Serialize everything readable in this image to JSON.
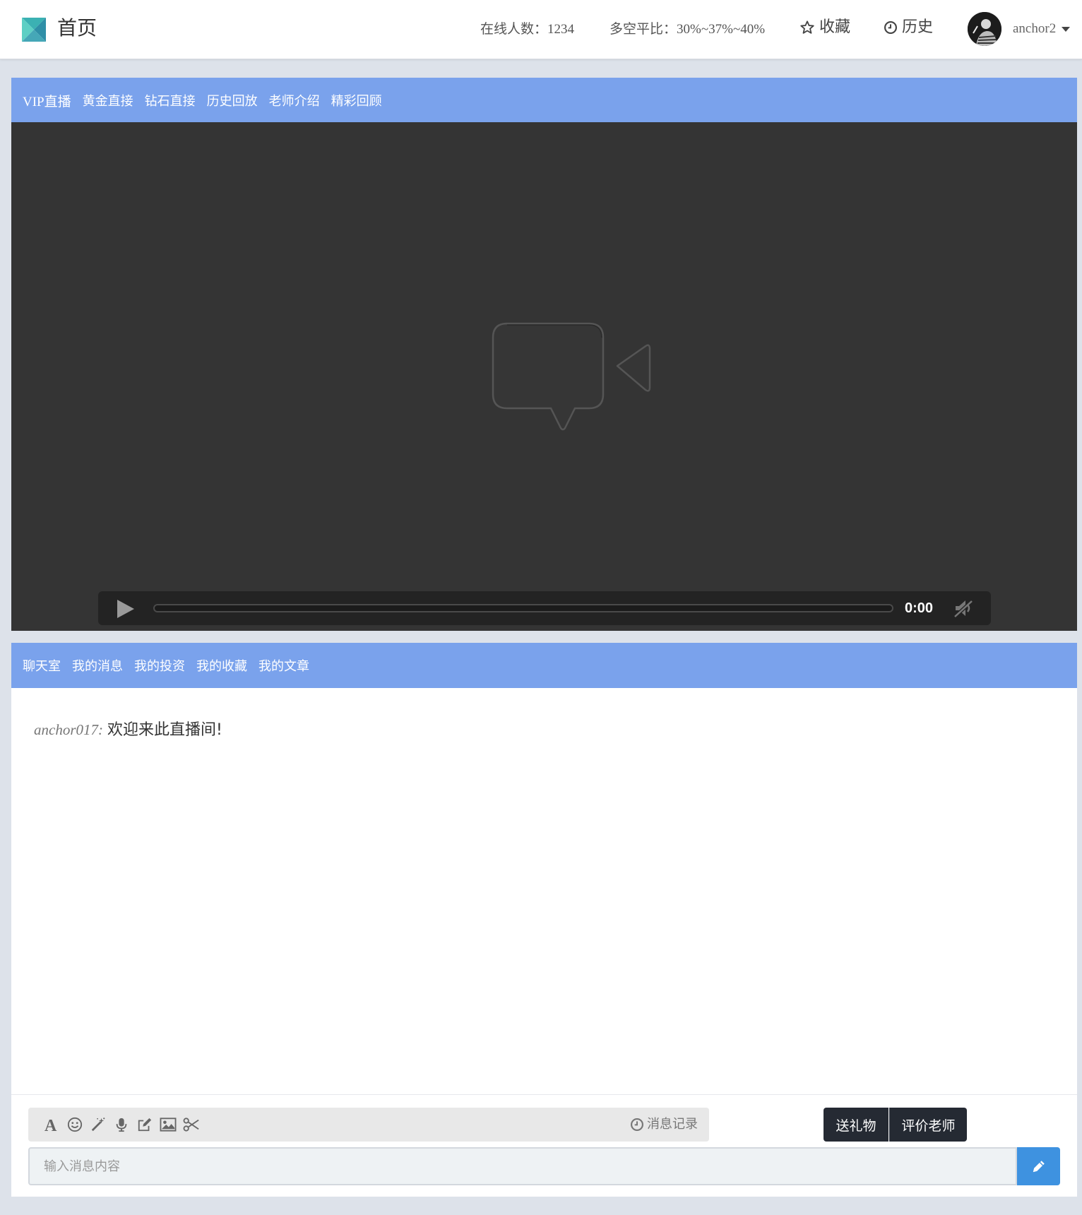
{
  "header": {
    "title": "首页",
    "online_label": "在线人数：",
    "online_count": "1234",
    "ratio_label": "多空平比：",
    "ratio_value": "30%~37%~40%",
    "favorites_label": "收藏",
    "history_label": "历史",
    "username": "anchor2",
    "icons": {
      "logo": "grid-logo-icon",
      "favorites": "star-icon",
      "history": "clock-icon",
      "user_menu": "caret-down-icon"
    }
  },
  "video_nav": {
    "items": [
      "VIP直播",
      "黄金直接",
      "钻石直接",
      "历史回放",
      "老师介绍",
      "精彩回顾"
    ]
  },
  "player": {
    "time": "0:00",
    "progress": 0,
    "icons": {
      "placeholder": "video-camera-icon",
      "play": "play-icon",
      "mute": "mute-icon"
    }
  },
  "chat_nav": {
    "items": [
      "聊天室",
      "我的消息",
      "我的投资",
      "我的收藏",
      "我的文章"
    ]
  },
  "chat": {
    "messages": [
      {
        "user": "anchor017:",
        "text": "欢迎来此直播间!"
      }
    ],
    "toolbar_icons": [
      "font-icon",
      "smiley-icon",
      "magic-wand-icon",
      "microphone-icon",
      "edit-icon",
      "image-icon",
      "scissors-icon"
    ],
    "history_label": "消息记录",
    "gift_label": "送礼物",
    "rate_label": "评价老师",
    "input_placeholder": "输入消息内容",
    "send_icon": "pencil-icon"
  },
  "colors": {
    "nav_bar": "#7aa2ec",
    "video_bg": "#343434",
    "send_button": "#3e92e0",
    "dark_button": "#252a33",
    "page_bg": "#dde2ea"
  }
}
